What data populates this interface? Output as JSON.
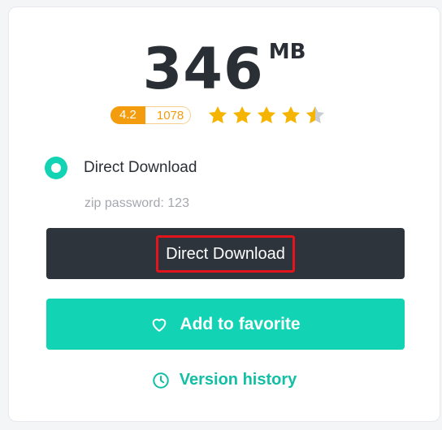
{
  "file": {
    "size_value": "346",
    "size_unit": "MB"
  },
  "rating": {
    "score": "4.2",
    "count": "1078",
    "stars_filled": 4.5,
    "stars_total": 5,
    "star_color": "#f5b400",
    "star_empty_color": "#c9ccd1"
  },
  "download_option": {
    "label": "Direct Download",
    "zip_password": "zip password: 123"
  },
  "buttons": {
    "direct_download": "Direct Download",
    "add_favorite": "Add to favorite",
    "version_history": "Version history"
  },
  "colors": {
    "accent": "#12d3b4",
    "dark_button": "#2d343b",
    "rating_badge": "#f29c0e",
    "highlight_border": "#e3141c"
  }
}
